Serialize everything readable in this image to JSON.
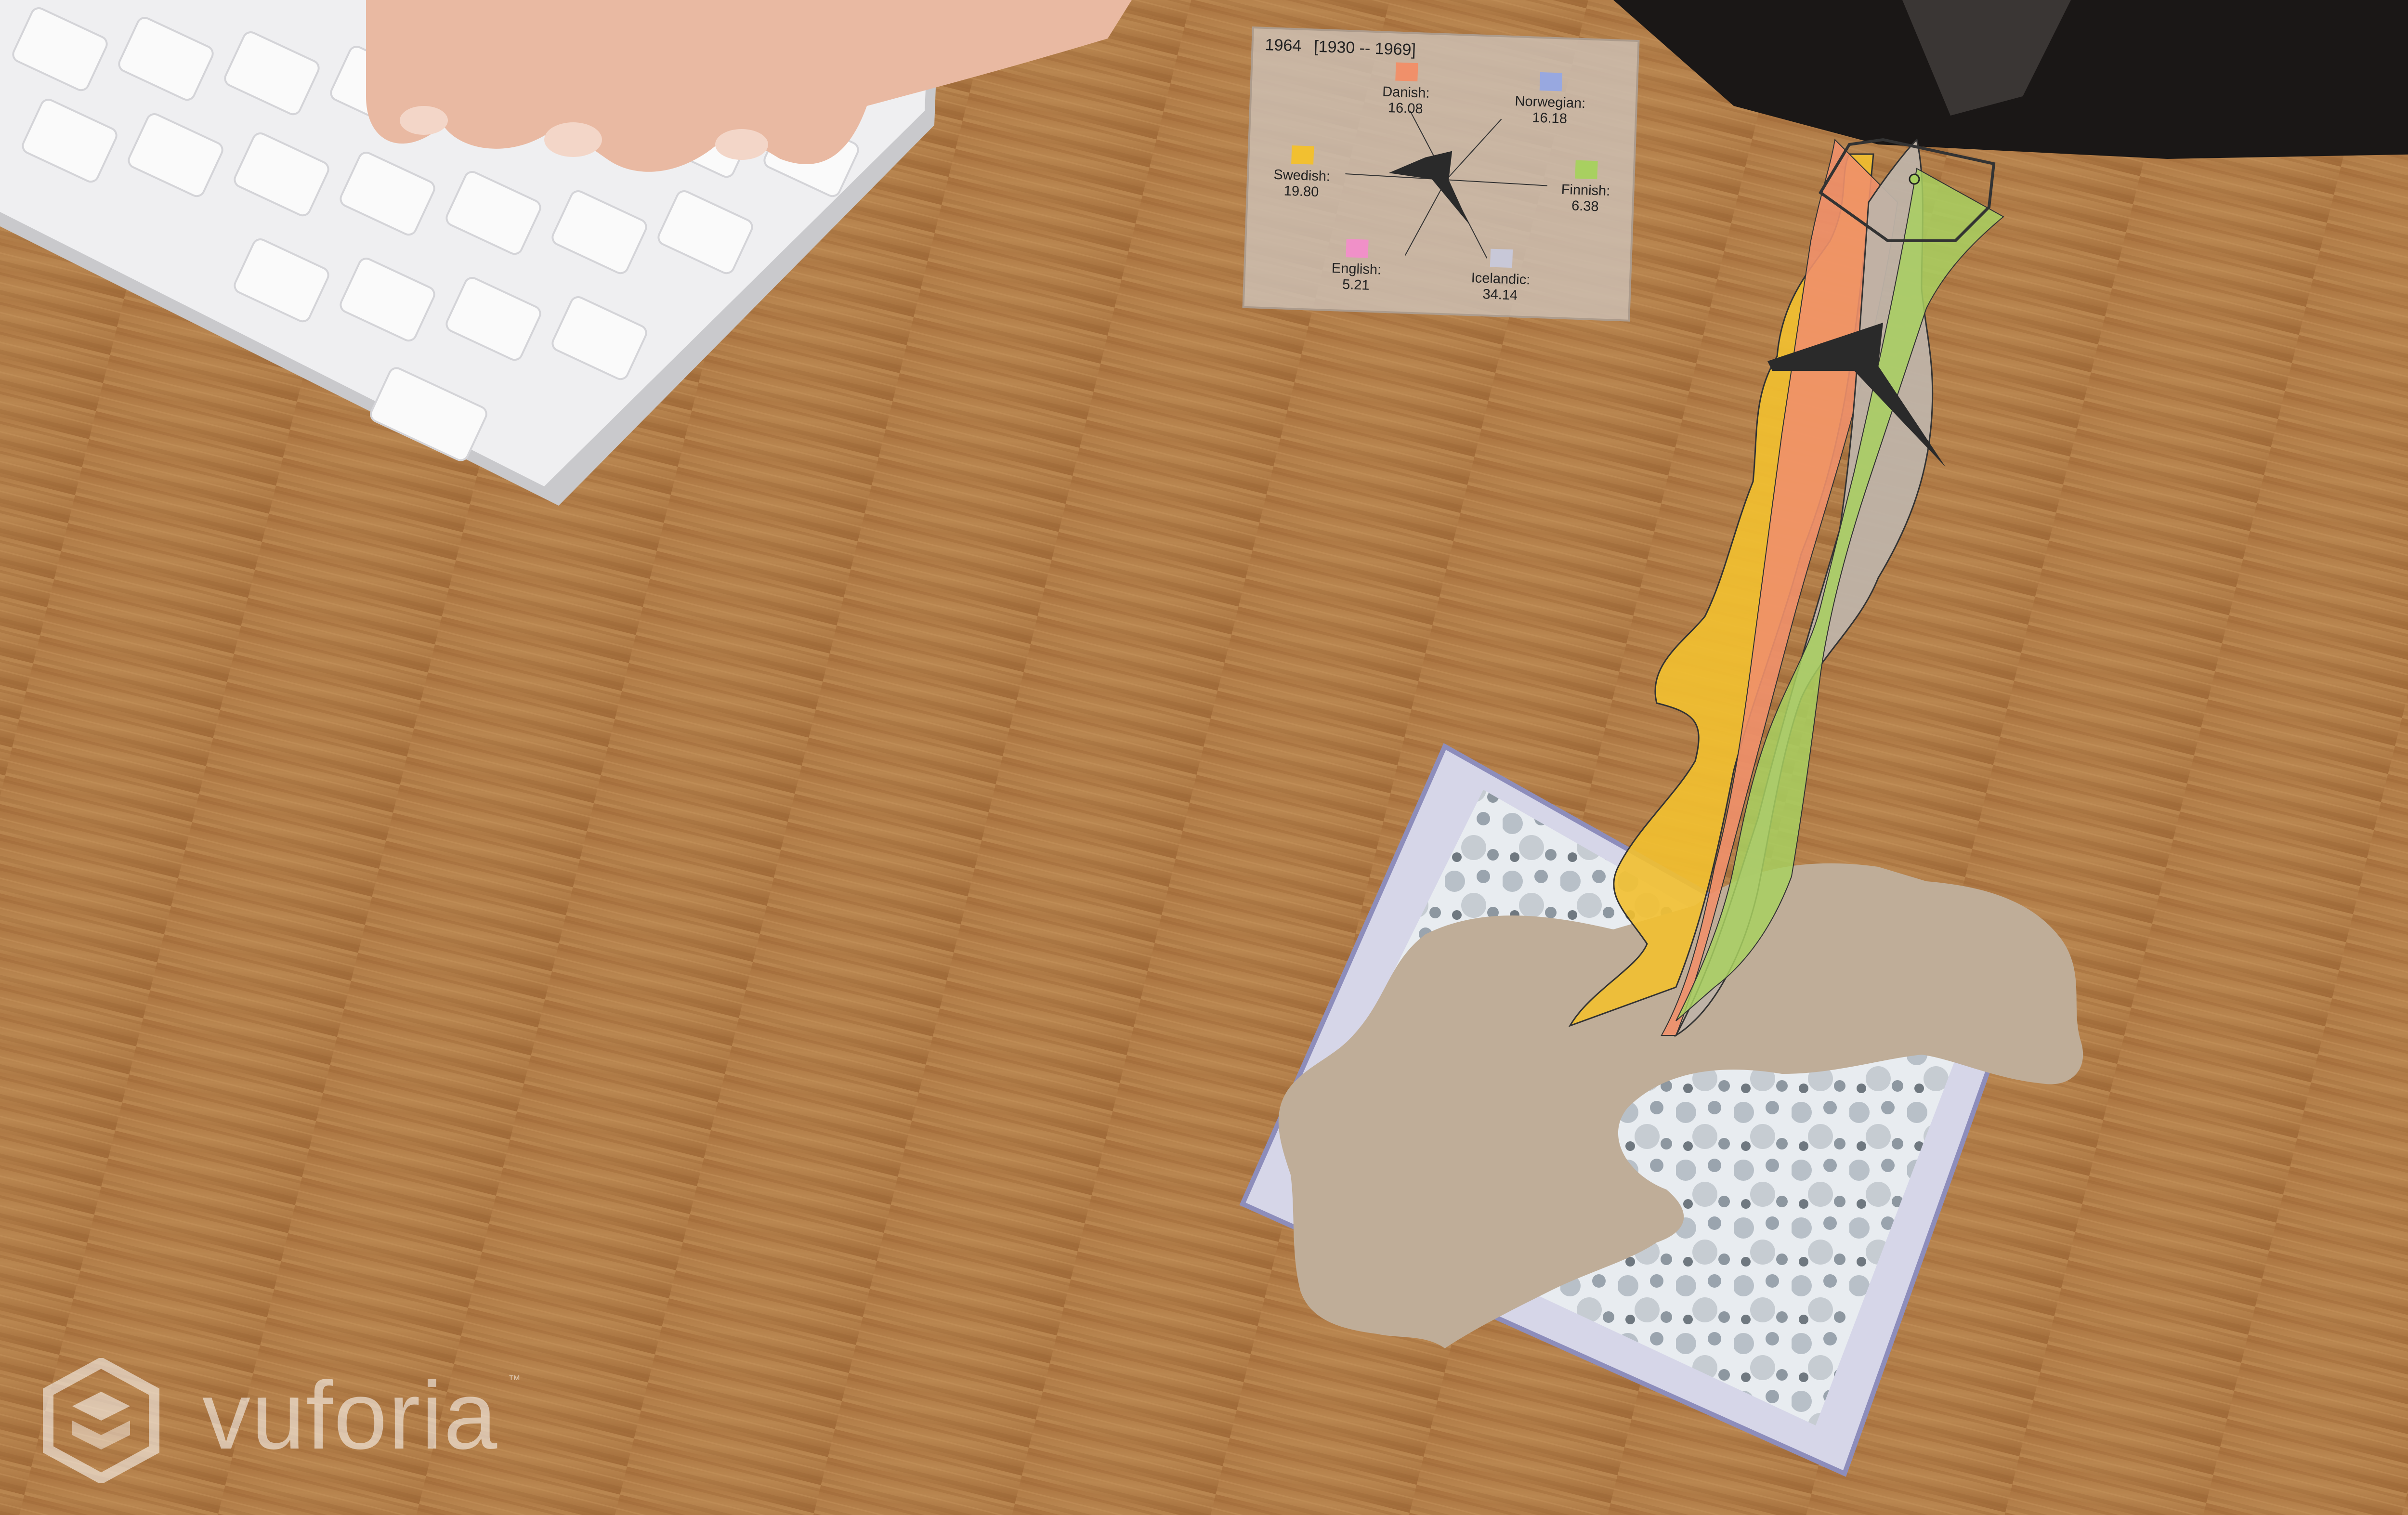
{
  "panel": {
    "year": "1964",
    "range": "[1930 -- 1969]",
    "languages": [
      {
        "name": "Danish:",
        "value": "16.08",
        "color": "#f0906a"
      },
      {
        "name": "Norwegian:",
        "value": "16.18",
        "color": "#98a8e0"
      },
      {
        "name": "Swedish:",
        "value": "19.80",
        "color": "#f2c030"
      },
      {
        "name": "Finnish:",
        "value": "6.38",
        "color": "#a8d060"
      },
      {
        "name": "English:",
        "value": "5.21",
        "color": "#f090c8"
      },
      {
        "name": "Icelandic:",
        "value": "34.14",
        "color": "#c8c8d8"
      }
    ]
  },
  "logo": {
    "word": "vuforia",
    "tm": "™"
  },
  "icons": {
    "logo": "vuforia-cube-icon"
  }
}
